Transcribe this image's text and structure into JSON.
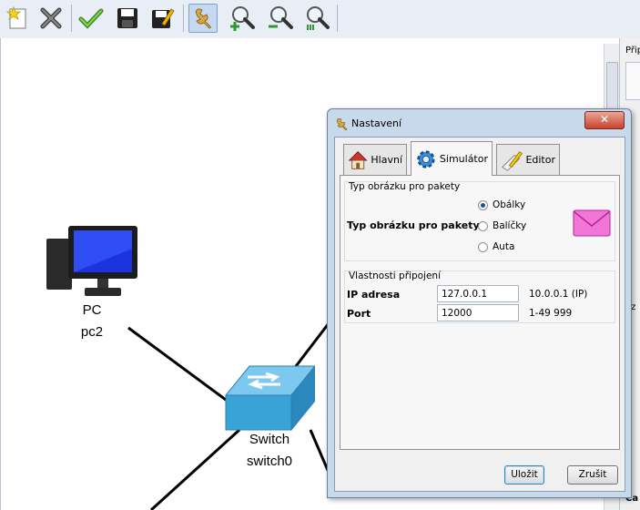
{
  "toolbar": {
    "buttons": [
      {
        "name": "new-icon"
      },
      {
        "name": "delete-icon"
      },
      {
        "name": "check-icon"
      },
      {
        "name": "save-icon"
      },
      {
        "name": "save-as-icon"
      },
      {
        "name": "settings-wrench-icon",
        "active": true
      },
      {
        "name": "zoom-in-icon"
      },
      {
        "name": "zoom-out-icon"
      },
      {
        "name": "zoom-reset-icon"
      }
    ]
  },
  "canvas": {
    "nodes": [
      {
        "type": "PC",
        "name": "pc2"
      },
      {
        "type": "Switch",
        "name": "switch0"
      }
    ]
  },
  "right_panel": {
    "labels": [
      "Přip",
      "ez",
      "Ca"
    ]
  },
  "dialog": {
    "title": "Nastavení",
    "tabs": [
      {
        "label": "Hlavní",
        "icon": "house-icon"
      },
      {
        "label": "Simulátor",
        "icon": "gear-icon",
        "selected": true
      },
      {
        "label": "Editor",
        "icon": "pencil-icon"
      }
    ],
    "packet_group": {
      "title": "Typ obrázku pro pakety",
      "label": "Typ obrázku pro pakety",
      "options": [
        {
          "label": "Obálky",
          "selected": true
        },
        {
          "label": "Balíčky",
          "selected": false
        },
        {
          "label": "Auta",
          "selected": false
        }
      ],
      "preview_icon": "envelope-icon"
    },
    "connection_group": {
      "title": "Vlastnosti připojení",
      "ip_label": "IP adresa",
      "ip_value": "127.0.0.1",
      "ip_hint": "10.0.0.1 (IP)",
      "port_label": "Port",
      "port_value": "12000",
      "port_hint": "1-49 999"
    },
    "buttons": {
      "ok": "Uložit",
      "cancel": "Zrušit"
    }
  },
  "colors": {
    "accent": "#3c7fb1",
    "envelope": "#e85ec8",
    "switch": "#3aa3d6"
  }
}
